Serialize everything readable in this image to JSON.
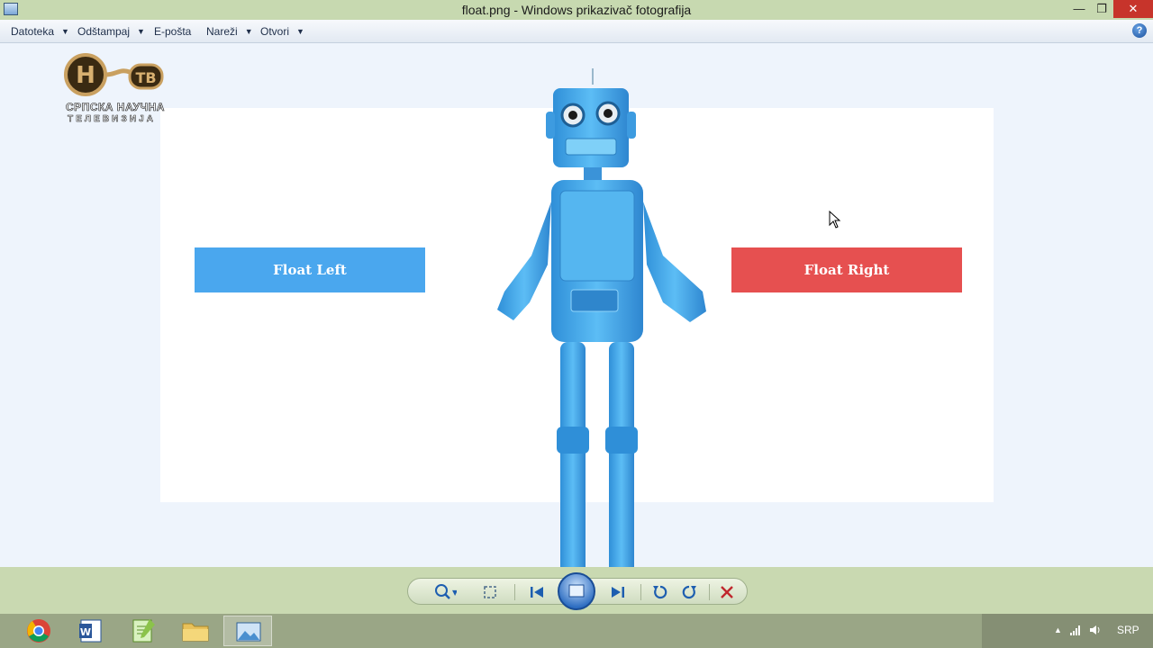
{
  "window": {
    "title": "float.png - Windows prikazivač fotografija",
    "minimize": "—",
    "maximize": "❐",
    "close": "✕"
  },
  "menu": {
    "items": [
      "Datoteka",
      "Odštampaj",
      "E-pošta",
      "Nareži",
      "Otvori"
    ],
    "help": "?"
  },
  "photo": {
    "left_button": "Float Left",
    "right_button": "Float Right",
    "logo_line1": "СРПСКА НАУЧНА",
    "logo_line2": "ТЕЛЕВИЗИЈА",
    "logo_mark": "ТВ"
  },
  "controls": {
    "zoom": "zoom-icon",
    "fit": "actual-size-icon",
    "previous": "previous-icon",
    "slideshow": "slideshow-icon",
    "next": "next-icon",
    "rotate_ccw": "rotate-counterclockwise-icon",
    "rotate_cw": "rotate-clockwise-icon",
    "delete": "delete-icon"
  },
  "taskbar": {
    "apps": [
      "chrome",
      "word",
      "notepad-plus-plus",
      "file-explorer",
      "photo-viewer"
    ],
    "language": "SRP"
  },
  "colors": {
    "float_left": "#4aa7ee",
    "float_right": "#e65050",
    "titlebar": "#c7d9b0",
    "close": "#c7342b"
  }
}
